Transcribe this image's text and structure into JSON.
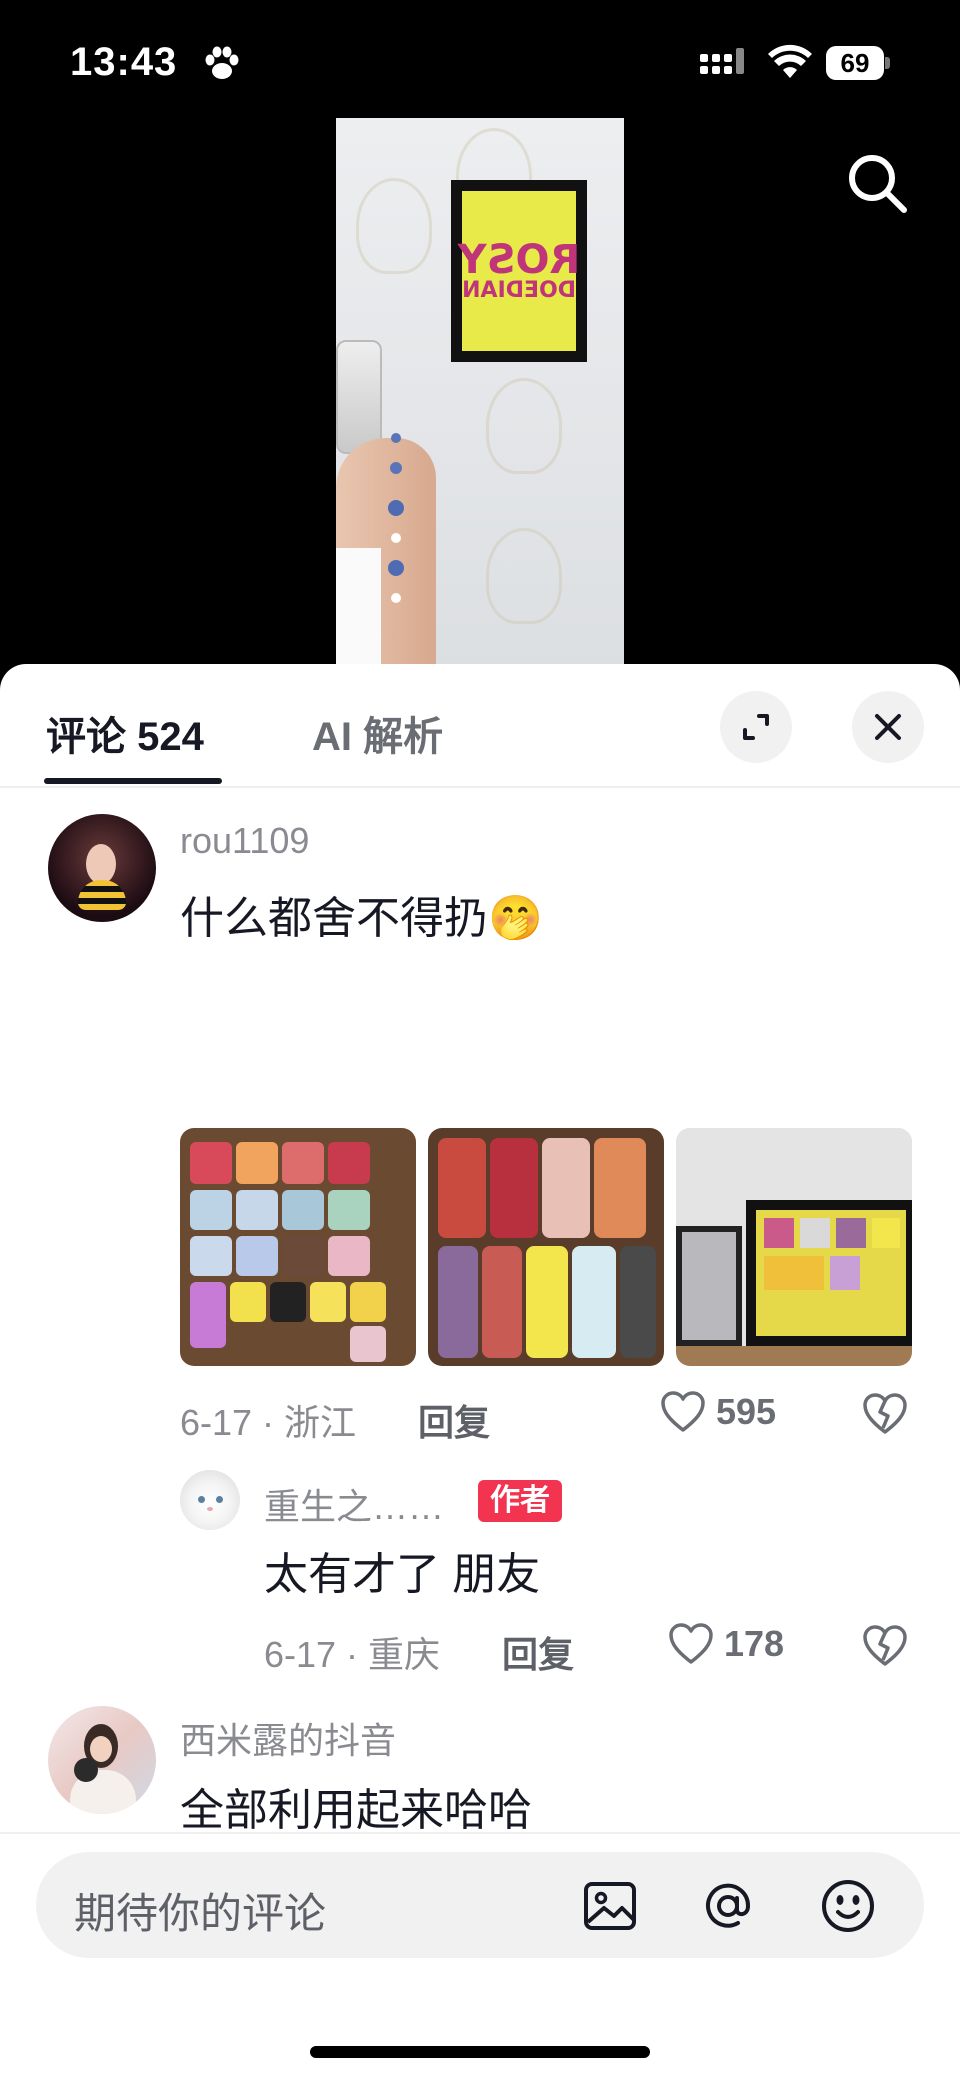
{
  "status_bar": {
    "time": "13:43",
    "battery": "69"
  },
  "video": {
    "frame_text_line1": "ROSY",
    "frame_text_line2": "DOEDIAN"
  },
  "comments_panel": {
    "tabs": [
      {
        "label": "评论 524"
      },
      {
        "label": "AI 解析"
      }
    ],
    "comments": [
      {
        "username": "rou1109",
        "text": "什么都舍不得扔🤭",
        "date_location": "6-17 · 浙江",
        "reply_label": "回复",
        "likes": "595",
        "photos": 3,
        "replies": [
          {
            "username": "重生之……",
            "badge": "作者",
            "text": "太有才了 朋友",
            "date_location": "6-17 · 重庆",
            "reply_label": "回复",
            "likes": "178"
          }
        ]
      },
      {
        "username": "西米露的抖音",
        "text": "全部利用起来哈哈"
      }
    ]
  },
  "input": {
    "placeholder": "期待你的评论"
  },
  "icons": {
    "search": "search-icon",
    "expand": "expand-icon",
    "close": "close-icon",
    "heart": "heart-icon",
    "broken_heart": "dislike-icon",
    "image": "image-icon",
    "mention": "at-icon",
    "emoji": "emoji-icon"
  },
  "colors": {
    "author_badge": "#f23450",
    "text_primary": "#161823",
    "text_secondary": "#8a8b91"
  }
}
